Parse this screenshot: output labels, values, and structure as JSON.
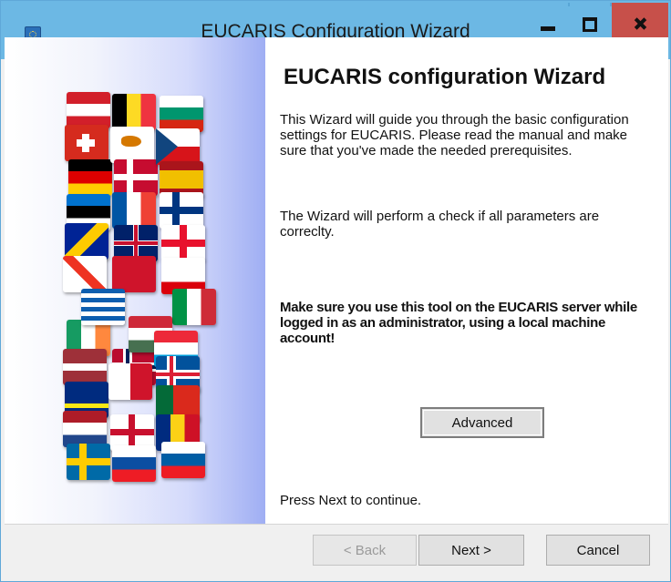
{
  "window": {
    "title": "EUCARIS Configuration Wizard"
  },
  "wizard": {
    "heading": "EUCARIS configuration Wizard",
    "intro": "This Wizard will guide you through the basic configuration settings for EUCARIS. Please read the manual and make sure that you've made the needed prerequisites.",
    "check_note": "The Wizard will perform a check if all parameters are correclty.",
    "admin_warning": "Make sure you use this tool on the EUCARIS server while logged in as an administrator, using a local machine account!",
    "advanced_label": "Advanced",
    "continue_hint": "Press Next to continue."
  },
  "footer": {
    "back_label": "< Back",
    "next_label": "Next >",
    "cancel_label": "Cancel"
  },
  "colors": {
    "titlebar": "#6cb8e4",
    "close_button": "#c7504a",
    "dialog_background": "#f0f0f0"
  },
  "icons": {
    "app": "app-icon",
    "minimize": "minimize-icon",
    "maximize": "maximize-icon",
    "close": "close-icon"
  },
  "illustration": {
    "name": "european-flags-collage"
  }
}
